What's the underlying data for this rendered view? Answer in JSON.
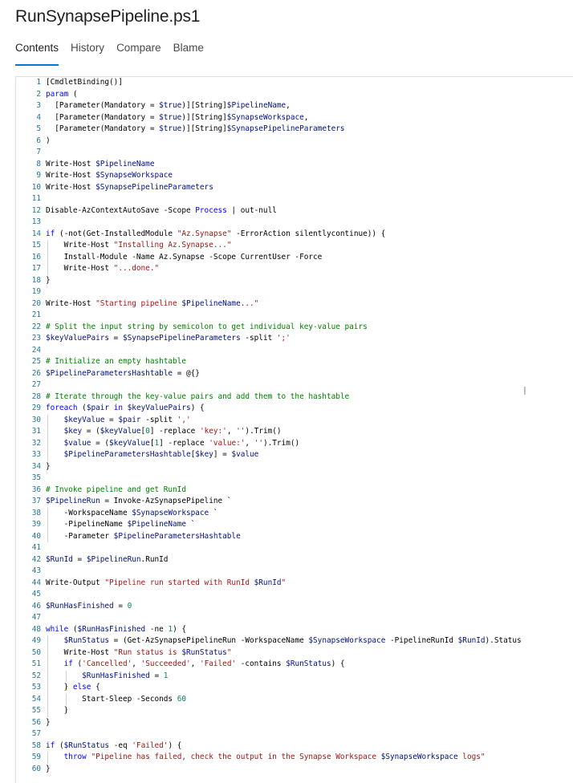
{
  "file": {
    "title": "RunSynapsePipeline.ps1"
  },
  "tabs": [
    {
      "label": "Contents",
      "active": true
    },
    {
      "label": "History",
      "active": false
    },
    {
      "label": "Compare",
      "active": false
    },
    {
      "label": "Blame",
      "active": false
    }
  ],
  "colors": {
    "accent": "#0078d4",
    "keyword": "#0000ff",
    "variable": "#001080",
    "string": "#a31515",
    "comment": "#008000",
    "number": "#098658",
    "line_number": "#237893"
  },
  "code_lines": [
    {
      "n": "1",
      "guides": 0,
      "tokens": [
        [
          "src",
          "[CmdletBinding()]"
        ]
      ]
    },
    {
      "n": "2",
      "guides": 0,
      "tokens": [
        [
          "kw",
          "param"
        ],
        [
          "src",
          " ("
        ]
      ]
    },
    {
      "n": "3",
      "guides": 0,
      "tokens": [
        [
          "src",
          "  [Parameter(Mandatory = "
        ],
        [
          "var",
          "$true"
        ],
        [
          "src",
          ")][String]"
        ],
        [
          "var",
          "$PipelineName"
        ],
        [
          "src",
          ","
        ]
      ]
    },
    {
      "n": "4",
      "guides": 0,
      "tokens": [
        [
          "src",
          "  [Parameter(Mandatory = "
        ],
        [
          "var",
          "$true"
        ],
        [
          "src",
          ")][String]"
        ],
        [
          "var",
          "$SynapseWorkspace"
        ],
        [
          "src",
          ","
        ]
      ]
    },
    {
      "n": "5",
      "guides": 0,
      "tokens": [
        [
          "src",
          "  [Parameter(Mandatory = "
        ],
        [
          "var",
          "$true"
        ],
        [
          "src",
          ")][String]"
        ],
        [
          "var",
          "$SynapsePipelineParameters"
        ]
      ]
    },
    {
      "n": "6",
      "guides": 0,
      "tokens": [
        [
          "src",
          ")"
        ]
      ]
    },
    {
      "n": "7",
      "guides": 0,
      "tokens": []
    },
    {
      "n": "8",
      "guides": 0,
      "tokens": [
        [
          "src",
          "Write-Host "
        ],
        [
          "var",
          "$PipelineName"
        ]
      ]
    },
    {
      "n": "9",
      "guides": 0,
      "tokens": [
        [
          "src",
          "Write-Host "
        ],
        [
          "var",
          "$SynapseWorkspace"
        ]
      ]
    },
    {
      "n": "10",
      "guides": 0,
      "tokens": [
        [
          "src",
          "Write-Host "
        ],
        [
          "var",
          "$SynapsePipelineParameters"
        ]
      ]
    },
    {
      "n": "11",
      "guides": 0,
      "tokens": []
    },
    {
      "n": "12",
      "guides": 0,
      "tokens": [
        [
          "src",
          "Disable-AzContextAutoSave -Scope "
        ],
        [
          "kw",
          "Process"
        ],
        [
          "src",
          " | out-null"
        ]
      ]
    },
    {
      "n": "13",
      "guides": 0,
      "tokens": []
    },
    {
      "n": "14",
      "guides": 0,
      "tokens": [
        [
          "kw",
          "if"
        ],
        [
          "src",
          " (-not(Get-InstalledModule "
        ],
        [
          "str",
          "\"Az.Synapse\""
        ],
        [
          "src",
          " -ErrorAction silentlycontinue)) {"
        ]
      ]
    },
    {
      "n": "15",
      "guides": 1,
      "tokens": [
        [
          "src",
          "    Write-Host "
        ],
        [
          "str",
          "\"Installing Az.Synapse...\""
        ]
      ]
    },
    {
      "n": "16",
      "guides": 1,
      "tokens": [
        [
          "src",
          "    Install-Module -Name Az.Synapse -Scope CurrentUser -Force"
        ]
      ]
    },
    {
      "n": "17",
      "guides": 1,
      "tokens": [
        [
          "src",
          "    Write-Host "
        ],
        [
          "str",
          "\"...done.\""
        ]
      ]
    },
    {
      "n": "18",
      "guides": 0,
      "tokens": [
        [
          "src",
          "}"
        ]
      ]
    },
    {
      "n": "19",
      "guides": 0,
      "tokens": []
    },
    {
      "n": "20",
      "guides": 0,
      "tokens": [
        [
          "src",
          "Write-Host "
        ],
        [
          "str",
          "\"Starting pipeline "
        ],
        [
          "var",
          "$PipelineName"
        ],
        [
          "str",
          "...\""
        ]
      ]
    },
    {
      "n": "21",
      "guides": 0,
      "tokens": []
    },
    {
      "n": "22",
      "guides": 0,
      "tokens": [
        [
          "cmt",
          "# Split the input string by semicolon to get individual key-value pairs"
        ]
      ]
    },
    {
      "n": "23",
      "guides": 0,
      "tokens": [
        [
          "var",
          "$keyValuePairs"
        ],
        [
          "src",
          " = "
        ],
        [
          "var",
          "$SynapsePipelineParameters"
        ],
        [
          "src",
          " -split "
        ],
        [
          "str",
          "';'"
        ]
      ]
    },
    {
      "n": "24",
      "guides": 0,
      "tokens": []
    },
    {
      "n": "25",
      "guides": 0,
      "tokens": [
        [
          "cmt",
          "# Initialize an empty hashtable"
        ]
      ]
    },
    {
      "n": "26",
      "guides": 0,
      "tokens": [
        [
          "var",
          "$PipelineParametersHashtable"
        ],
        [
          "src",
          " = @{}"
        ]
      ]
    },
    {
      "n": "27",
      "guides": 0,
      "tokens": []
    },
    {
      "n": "28",
      "guides": 0,
      "tokens": [
        [
          "cmt",
          "# Iterate through the key-value pairs and add them to the hashtable"
        ]
      ]
    },
    {
      "n": "29",
      "guides": 0,
      "tokens": [
        [
          "kw",
          "foreach"
        ],
        [
          "src",
          " ("
        ],
        [
          "var",
          "$pair"
        ],
        [
          "src",
          " "
        ],
        [
          "kw",
          "in"
        ],
        [
          "src",
          " "
        ],
        [
          "var",
          "$keyValuePairs"
        ],
        [
          "src",
          ") {"
        ]
      ]
    },
    {
      "n": "30",
      "guides": 1,
      "tokens": [
        [
          "src",
          "    "
        ],
        [
          "var",
          "$keyValue"
        ],
        [
          "src",
          " = "
        ],
        [
          "var",
          "$pair"
        ],
        [
          "src",
          " -split "
        ],
        [
          "str",
          "','"
        ]
      ]
    },
    {
      "n": "31",
      "guides": 1,
      "tokens": [
        [
          "src",
          "    "
        ],
        [
          "var",
          "$key"
        ],
        [
          "src",
          " = ("
        ],
        [
          "var",
          "$keyValue"
        ],
        [
          "src",
          "["
        ],
        [
          "num",
          "0"
        ],
        [
          "src",
          "] -replace "
        ],
        [
          "str",
          "'key:'"
        ],
        [
          "src",
          ", "
        ],
        [
          "str",
          "''"
        ],
        [
          "src",
          ").Trim()"
        ]
      ]
    },
    {
      "n": "32",
      "guides": 1,
      "tokens": [
        [
          "src",
          "    "
        ],
        [
          "var",
          "$value"
        ],
        [
          "src",
          " = ("
        ],
        [
          "var",
          "$keyValue"
        ],
        [
          "src",
          "["
        ],
        [
          "num",
          "1"
        ],
        [
          "src",
          "] -replace "
        ],
        [
          "str",
          "'value:'"
        ],
        [
          "src",
          ", "
        ],
        [
          "str",
          "''"
        ],
        [
          "src",
          ").Trim()"
        ]
      ]
    },
    {
      "n": "33",
      "guides": 1,
      "tokens": [
        [
          "src",
          "    "
        ],
        [
          "var",
          "$PipelineParametersHashtable"
        ],
        [
          "src",
          "["
        ],
        [
          "var",
          "$key"
        ],
        [
          "src",
          "] = "
        ],
        [
          "var",
          "$value"
        ]
      ]
    },
    {
      "n": "34",
      "guides": 0,
      "tokens": [
        [
          "src",
          "}"
        ]
      ]
    },
    {
      "n": "35",
      "guides": 0,
      "tokens": []
    },
    {
      "n": "36",
      "guides": 0,
      "tokens": [
        [
          "cmt",
          "# Invoke pipeline and get RunId"
        ]
      ]
    },
    {
      "n": "37",
      "guides": 0,
      "tokens": [
        [
          "var",
          "$PipelineRun"
        ],
        [
          "src",
          " = Invoke-AzSynapsePipeline `"
        ]
      ]
    },
    {
      "n": "38",
      "guides": 1,
      "tokens": [
        [
          "src",
          "    -WorkspaceName "
        ],
        [
          "var",
          "$SynapseWorkspace"
        ],
        [
          "src",
          " `"
        ]
      ]
    },
    {
      "n": "39",
      "guides": 1,
      "tokens": [
        [
          "src",
          "    -PipelineName "
        ],
        [
          "var",
          "$PipelineName"
        ],
        [
          "src",
          " `"
        ]
      ]
    },
    {
      "n": "40",
      "guides": 1,
      "tokens": [
        [
          "src",
          "    -Parameter "
        ],
        [
          "var",
          "$PipelineParametersHashtable"
        ]
      ]
    },
    {
      "n": "41",
      "guides": 0,
      "tokens": []
    },
    {
      "n": "42",
      "guides": 0,
      "tokens": [
        [
          "var",
          "$RunId"
        ],
        [
          "src",
          " = "
        ],
        [
          "var",
          "$PipelineRun"
        ],
        [
          "src",
          ".RunId"
        ]
      ]
    },
    {
      "n": "43",
      "guides": 0,
      "tokens": []
    },
    {
      "n": "44",
      "guides": 0,
      "tokens": [
        [
          "src",
          "Write-Output "
        ],
        [
          "str",
          "\"Pipeline run started with RunId "
        ],
        [
          "var",
          "$RunId"
        ],
        [
          "str",
          "\""
        ]
      ]
    },
    {
      "n": "45",
      "guides": 0,
      "tokens": []
    },
    {
      "n": "46",
      "guides": 0,
      "tokens": [
        [
          "var",
          "$RunHasFinished"
        ],
        [
          "src",
          " = "
        ],
        [
          "num",
          "0"
        ]
      ]
    },
    {
      "n": "47",
      "guides": 0,
      "tokens": []
    },
    {
      "n": "48",
      "guides": 0,
      "tokens": [
        [
          "kw",
          "while"
        ],
        [
          "src",
          " ("
        ],
        [
          "var",
          "$RunHasFinished"
        ],
        [
          "src",
          " -ne "
        ],
        [
          "num",
          "1"
        ],
        [
          "src",
          ") {"
        ]
      ]
    },
    {
      "n": "49",
      "guides": 1,
      "tokens": [
        [
          "src",
          "    "
        ],
        [
          "var",
          "$RunStatus"
        ],
        [
          "src",
          " = (Get-AzSynapsePipelineRun -WorkspaceName "
        ],
        [
          "var",
          "$SynapseWorkspace"
        ],
        [
          "src",
          " -PipelineRunId "
        ],
        [
          "var",
          "$RunId"
        ],
        [
          "src",
          ").Status"
        ]
      ]
    },
    {
      "n": "50",
      "guides": 1,
      "tokens": [
        [
          "src",
          "    Write-Host "
        ],
        [
          "str",
          "\"Run status is "
        ],
        [
          "var",
          "$RunStatus"
        ],
        [
          "str",
          "\""
        ]
      ]
    },
    {
      "n": "51",
      "guides": 1,
      "tokens": [
        [
          "src",
          "    "
        ],
        [
          "kw",
          "if"
        ],
        [
          "src",
          " ("
        ],
        [
          "str",
          "'Cancelled'"
        ],
        [
          "src",
          ", "
        ],
        [
          "str",
          "'Succeeded'"
        ],
        [
          "src",
          ", "
        ],
        [
          "str",
          "'Failed'"
        ],
        [
          "src",
          " -contains "
        ],
        [
          "var",
          "$RunStatus"
        ],
        [
          "src",
          ") {"
        ]
      ]
    },
    {
      "n": "52",
      "guides": 2,
      "tokens": [
        [
          "src",
          "        "
        ],
        [
          "var",
          "$RunHasFinished"
        ],
        [
          "src",
          " = "
        ],
        [
          "num",
          "1"
        ]
      ]
    },
    {
      "n": "53",
      "guides": 1,
      "tokens": [
        [
          "src",
          "    } "
        ],
        [
          "kw",
          "else"
        ],
        [
          "src",
          " {"
        ]
      ]
    },
    {
      "n": "54",
      "guides": 2,
      "tokens": [
        [
          "src",
          "        Start-Sleep -Seconds "
        ],
        [
          "num",
          "60"
        ]
      ]
    },
    {
      "n": "55",
      "guides": 1,
      "tokens": [
        [
          "src",
          "    }"
        ]
      ]
    },
    {
      "n": "56",
      "guides": 0,
      "tokens": [
        [
          "src",
          "}"
        ]
      ]
    },
    {
      "n": "57",
      "guides": 0,
      "tokens": []
    },
    {
      "n": "58",
      "guides": 0,
      "tokens": [
        [
          "kw",
          "if"
        ],
        [
          "src",
          " ("
        ],
        [
          "var",
          "$RunStatus"
        ],
        [
          "src",
          " -eq "
        ],
        [
          "str",
          "'Failed'"
        ],
        [
          "src",
          ") {"
        ]
      ]
    },
    {
      "n": "59",
      "guides": 1,
      "tokens": [
        [
          "src",
          "    "
        ],
        [
          "kw",
          "throw"
        ],
        [
          "src",
          " "
        ],
        [
          "str",
          "\"Pipeline has failed, check the output in the Synapse Workspace "
        ],
        [
          "var",
          "$SynapseWorkspace"
        ],
        [
          "str",
          " logs\""
        ]
      ]
    },
    {
      "n": "60",
      "guides": 0,
      "tokens": [
        [
          "src",
          "}"
        ]
      ]
    }
  ]
}
